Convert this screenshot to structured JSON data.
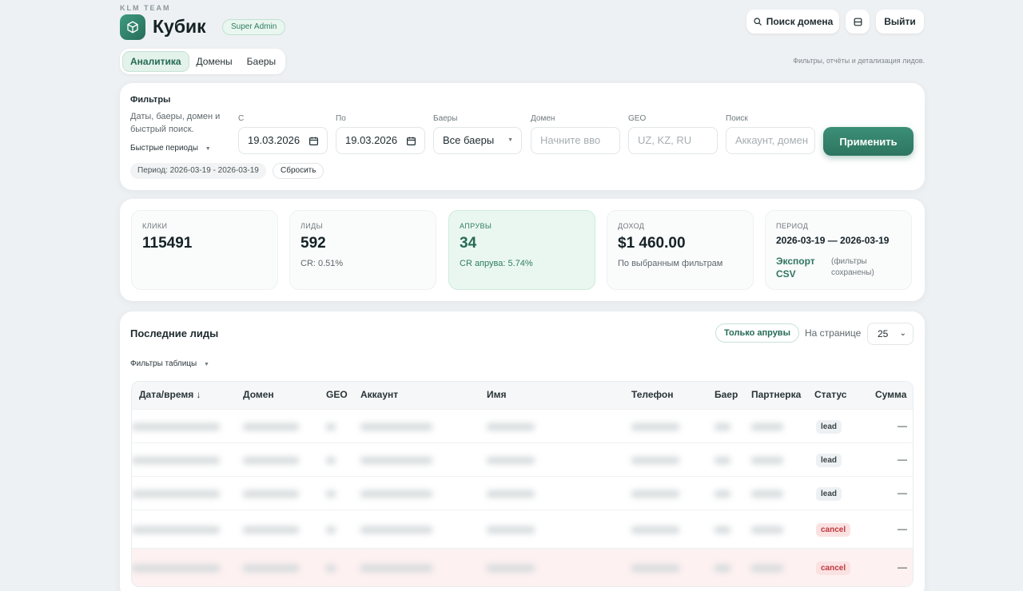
{
  "header": {
    "team": "KLM TEAM",
    "title": "Кубик",
    "role": "Super Admin",
    "search_domain": "Поиск домена",
    "logout": "Выйти"
  },
  "tabs": [
    {
      "label": "Аналитика",
      "active": true
    },
    {
      "label": "Домены",
      "active": false
    },
    {
      "label": "Баеры",
      "active": false
    }
  ],
  "subtitle": "Фильтры, отчёты и детализация лидов.",
  "filters": {
    "title": "Фильтры",
    "description": "Даты, баеры, домен и быстрый поиск.",
    "quick_periods": "Быстрые периоды",
    "period_chip": "Период: 2026-03-19 - 2026-03-19",
    "reset": "Сбросить",
    "from_label": "С",
    "from_value": "19.03.2026",
    "to_label": "По",
    "to_value": "19.03.2026",
    "buyers_label": "Баеры",
    "buyers_value": "Все баеры",
    "domain_label": "Домен",
    "domain_placeholder": "Начните вво",
    "geo_label": "GEO",
    "geo_placeholder": "UZ, KZ, RU",
    "search_label": "Поиск",
    "search_placeholder": "Аккаунт, домен",
    "apply": "Применить"
  },
  "stats": {
    "clicks": {
      "label": "КЛИКИ",
      "value": "115491"
    },
    "leads": {
      "label": "ЛИДЫ",
      "value": "592",
      "sub": "CR: 0.51%"
    },
    "approves": {
      "label": "АПРУВЫ",
      "value": "34",
      "sub": "CR апрува: 5.74%"
    },
    "income": {
      "label": "ДОХОД",
      "value": "$1 460.00",
      "sub": "По выбранным фильтрам"
    },
    "period": {
      "label": "ПЕРИОД",
      "value": "2026-03-19 — 2026-03-19",
      "export": "Экспорт CSV",
      "note": "(фильтры сохранены)"
    }
  },
  "table": {
    "title": "Последние лиды",
    "filters": "Фильтры таблицы",
    "only_approves": "Только апрувы",
    "per_page_label": "На странице",
    "per_page_value": "25",
    "columns": [
      "Дата/время ↓",
      "Домен",
      "GEO",
      "Аккаунт",
      "Имя",
      "Телефон",
      "Баер",
      "Партнерка",
      "Статус",
      "Сумма"
    ],
    "rows": [
      {
        "status": "lead",
        "sum": "—",
        "highlight": false
      },
      {
        "status": "lead",
        "sum": "—",
        "highlight": false
      },
      {
        "status": "lead",
        "sum": "—",
        "highlight": false
      },
      {
        "status": "cancel",
        "sum": "—",
        "highlight": false
      },
      {
        "status": "cancel",
        "sum": "—",
        "highlight": true
      }
    ]
  },
  "colors": {
    "accent": "#2e7560",
    "accent_light": "#eaf7f0",
    "cancel": "#c0383f"
  }
}
